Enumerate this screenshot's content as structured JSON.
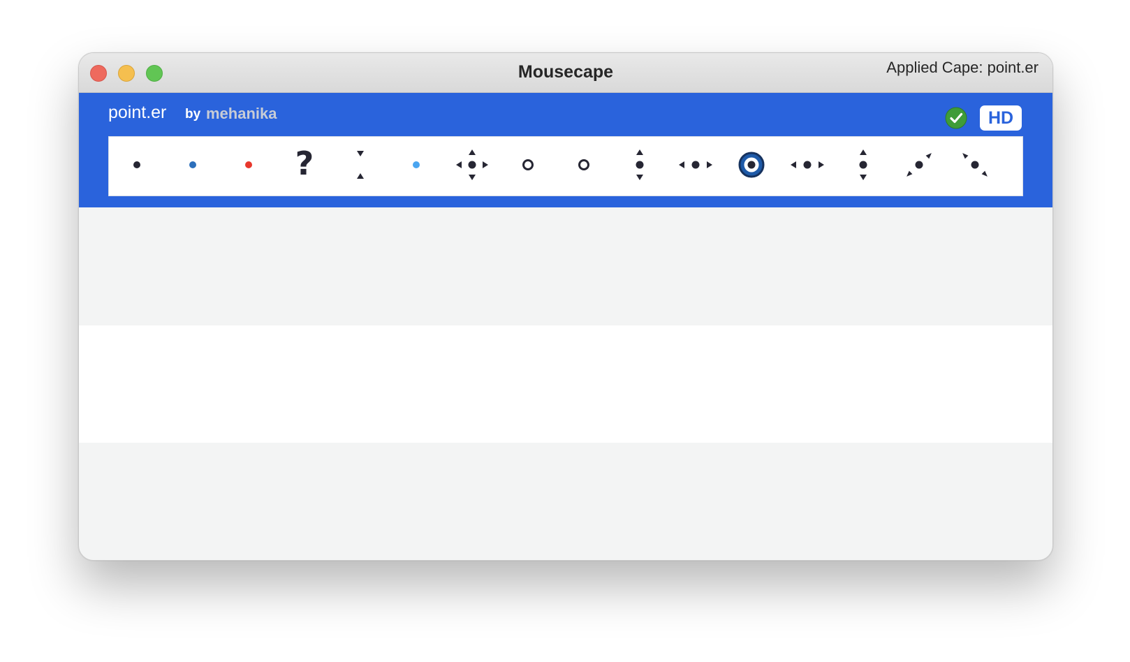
{
  "window": {
    "title": "Mousecape",
    "status": "Applied Cape: point.er"
  },
  "cape": {
    "name": "point.er",
    "by_label": "by",
    "author": "mehanika",
    "applied": true,
    "hd_badge": "HD",
    "accent_color": "#2a63dc",
    "cursors": [
      {
        "icon": "arrow-dot-cursor-icon",
        "dot_color": "#262633"
      },
      {
        "icon": "link-dot-cursor-icon",
        "dot_color": "#2c6fbb"
      },
      {
        "icon": "not-allowed-dot-cursor-icon",
        "dot_color": "#e8372c"
      },
      {
        "icon": "help-question-cursor-icon",
        "glyph": "?"
      },
      {
        "icon": "resize-up-down-cursor-icon"
      },
      {
        "icon": "context-dot-cursor-icon",
        "dot_color": "#4aa5f0"
      },
      {
        "icon": "move-cursor-icon"
      },
      {
        "icon": "ring-cursor-icon"
      },
      {
        "icon": "ring-cursor-icon"
      },
      {
        "icon": "resize-vertical-cursor-icon"
      },
      {
        "icon": "resize-horizontal-cursor-icon"
      },
      {
        "icon": "busy-target-cursor-icon",
        "ring_color": "#1e5aa8"
      },
      {
        "icon": "resize-horizontal-cursor-icon"
      },
      {
        "icon": "resize-vertical-cursor-icon"
      },
      {
        "icon": "resize-diagonal-ne-cursor-icon"
      },
      {
        "icon": "resize-diagonal-nw-cursor-icon"
      }
    ]
  }
}
